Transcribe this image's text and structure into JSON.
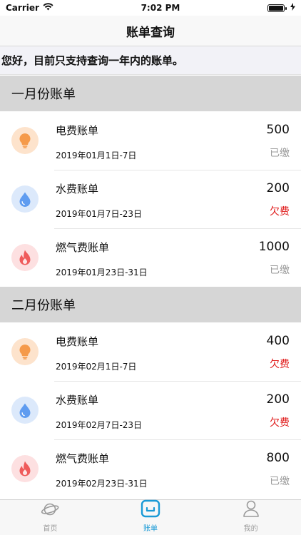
{
  "status_bar": {
    "carrier": "Carrier",
    "time": "7:02 PM"
  },
  "nav": {
    "title": "账单查询"
  },
  "notice": "您好，目前只支持查询一年内的账单。",
  "colors": {
    "paid": "#9a9a9a",
    "owed": "#e01b1b",
    "electric_bg": "#fde3cc",
    "electric_fg": "#f59a4a",
    "water_bg": "#dce9fb",
    "water_fg": "#5f9cf0",
    "gas_bg": "#fde0e1",
    "gas_fg": "#ef5b5b",
    "tab_active": "#1a9ad6",
    "tab_inactive": "#9a9a9a"
  },
  "sections": [
    {
      "title": "一月份账单",
      "bills": [
        {
          "type": "electric",
          "name": "电费账单",
          "date": "2019年01月1日-7日",
          "amount": "500",
          "status": "已缴",
          "owed": false
        },
        {
          "type": "water",
          "name": "水费账单",
          "date": "2019年01月7日-23日",
          "amount": "200",
          "status": "欠费",
          "owed": true
        },
        {
          "type": "gas",
          "name": "燃气费账单",
          "date": "2019年01月23日-31日",
          "amount": "1000",
          "status": "已缴",
          "owed": false
        }
      ]
    },
    {
      "title": "二月份账单",
      "bills": [
        {
          "type": "electric",
          "name": "电费账单",
          "date": "2019年02月1日-7日",
          "amount": "400",
          "status": "欠费",
          "owed": true
        },
        {
          "type": "water",
          "name": "水费账单",
          "date": "2019年02月7日-23日",
          "amount": "200",
          "status": "欠费",
          "owed": true
        },
        {
          "type": "gas",
          "name": "燃气费账单",
          "date": "2019年02月23日-31日",
          "amount": "800",
          "status": "已缴",
          "owed": false
        }
      ]
    }
  ],
  "tabs": [
    {
      "label": "首页",
      "icon": "planet-icon",
      "active": false
    },
    {
      "label": "账单",
      "icon": "bill-box-icon",
      "active": true
    },
    {
      "label": "我的",
      "icon": "person-icon",
      "active": false
    }
  ]
}
